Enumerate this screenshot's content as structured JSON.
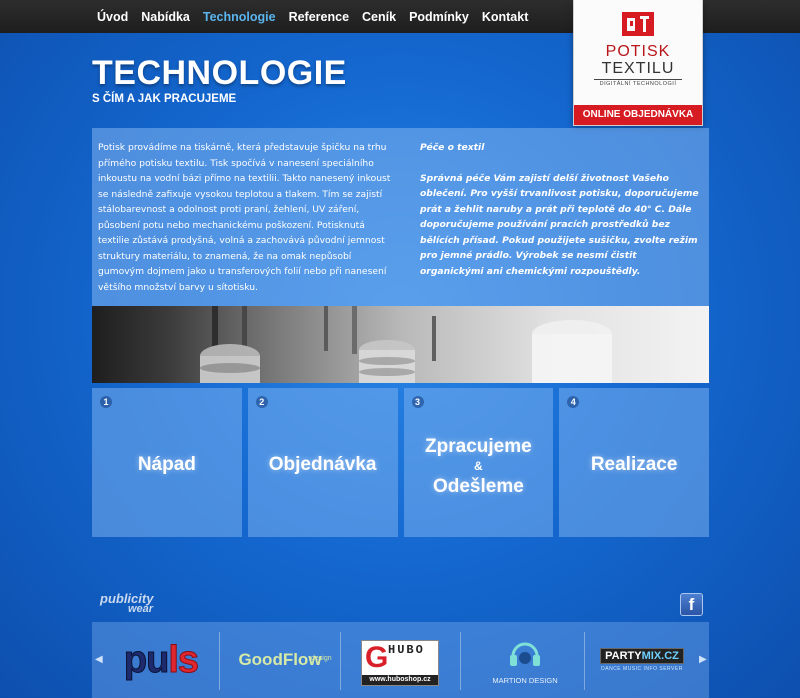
{
  "nav": {
    "items": [
      {
        "label": "Úvod"
      },
      {
        "label": "Nabídka"
      },
      {
        "label": "Technologie",
        "active": true
      },
      {
        "label": "Reference"
      },
      {
        "label": "Ceník"
      },
      {
        "label": "Podmínky"
      },
      {
        "label": "Kontakt"
      }
    ],
    "active_color": "#5ab4ee"
  },
  "logo": {
    "line1": "POTISK",
    "line2": "TEXTILU",
    "tagline": "DIGITÁLNÍ TECHNOLOGIÍ",
    "order_label": "ONLINE OBJEDNÁVKA",
    "brand_color": "#d71b22"
  },
  "page": {
    "title": "TECHNOLOGIE",
    "subtitle": "S ČÍM A JAK PRACUJEME"
  },
  "content": {
    "left_text": "Potisk provádíme na tiskárně, která představuje špičku na trhu přímého potisku textilu. Tisk spočívá v nanesení speciálního inkoustu na vodní bázi přímo na textilii. Takto nanesený inkoust se následně zafixuje vysokou teplotou a tlakem. Tím se zajistí stálobarevnost a odolnost proti praní, žehlení, UV záření, působení potu nebo mechanickému poškození. Potisknutá textilie zůstává prodyšná, volná a zachovává původní jemnost struktury materiálu, to znamená, že na omak nepůsobí gumovým dojmem jako u transferových folií nebo při nanesení většího množství barvy u sítotisku.",
    "care_title": "Péče o textil",
    "care_text": "Správná péče Vám zajistí delší životnost Vašeho oblečení. Pro vyšší trvanlivost potisku, doporučujeme prát a žehlit naruby a prát při teplotě do 40° C. Dále doporučujeme používání pracích prostředků bez bělících přísad. Pokud použijete sušičku, zvolte režim pro jemné prádlo. Výrobek se nesmí čistit organickými ani chemickými rozpouštědly."
  },
  "steps": [
    {
      "number": "1",
      "label": "Nápad"
    },
    {
      "number": "2",
      "label": "Objednávka"
    },
    {
      "number": "3",
      "label": "Zpracujeme",
      "amp": "&",
      "label2": "Odešleme"
    },
    {
      "number": "4",
      "label": "Realizace"
    }
  ],
  "footer": {
    "brand_logo_line1": "publicity",
    "brand_logo_line2": "wear",
    "facebook_icon": "f",
    "partners": {
      "puls_a": "pu",
      "puls_b": "ls",
      "goodflow": "GoodFlow",
      "goodflow_small": "design",
      "hubo_letter": "G",
      "hubo_text": "HUBO",
      "hubo_url": "www.huboshop.cz",
      "martion": "MARTION DESIGN",
      "partymix_a": "PARTY",
      "partymix_b": "MIX.CZ",
      "partymix_sub": "DANCE MUSIC INFO SERVER"
    },
    "arrow_left": "◀",
    "arrow_right": "▶"
  }
}
